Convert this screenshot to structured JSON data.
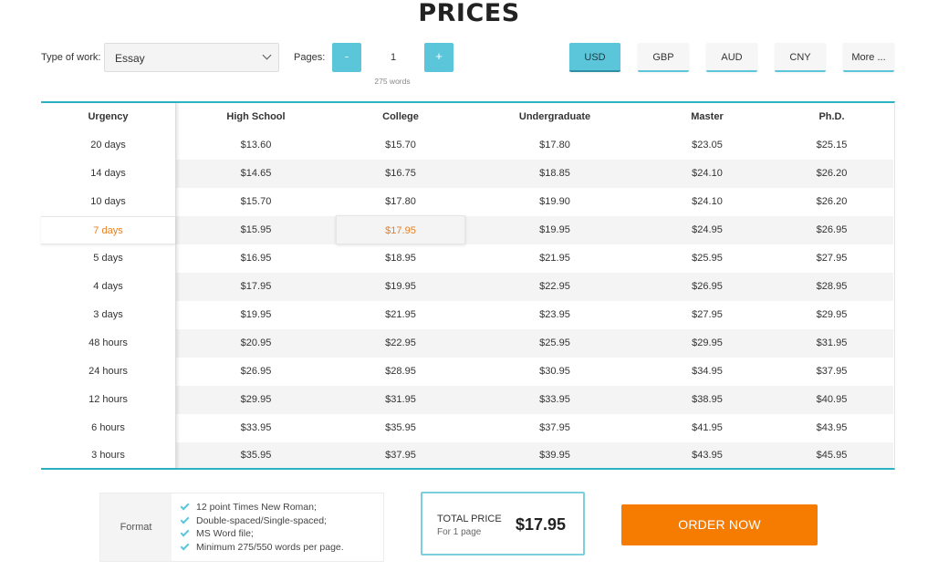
{
  "title": "PRICES",
  "controls": {
    "type_label": "Type of work:",
    "type_value": "Essay",
    "pages_label": "Pages:",
    "minus": "-",
    "plus": "+",
    "pages_value": "1",
    "words_note": "275 words"
  },
  "currencies": [
    "USD",
    "GBP",
    "AUD",
    "CNY",
    "More ..."
  ],
  "active_currency": "USD",
  "table": {
    "urgency_header": "Urgency",
    "levels": [
      "High School",
      "College",
      "Undergraduate",
      "Master",
      "Ph.D."
    ],
    "rows": [
      {
        "urgency": "20 days",
        "prices": [
          "$13.60",
          "$15.70",
          "$17.80",
          "$23.05",
          "$25.15"
        ]
      },
      {
        "urgency": "14 days",
        "prices": [
          "$14.65",
          "$16.75",
          "$18.85",
          "$24.10",
          "$26.20"
        ]
      },
      {
        "urgency": "10 days",
        "prices": [
          "$15.70",
          "$17.80",
          "$19.90",
          "$24.10",
          "$26.20"
        ]
      },
      {
        "urgency": "7 days",
        "prices": [
          "$15.95",
          "$17.95",
          "$19.95",
          "$24.95",
          "$26.95"
        ]
      },
      {
        "urgency": "5 days",
        "prices": [
          "$16.95",
          "$18.95",
          "$21.95",
          "$25.95",
          "$27.95"
        ]
      },
      {
        "urgency": "4 days",
        "prices": [
          "$17.95",
          "$19.95",
          "$22.95",
          "$26.95",
          "$28.95"
        ]
      },
      {
        "urgency": "3 days",
        "prices": [
          "$19.95",
          "$21.95",
          "$23.95",
          "$27.95",
          "$29.95"
        ]
      },
      {
        "urgency": "48 hours",
        "prices": [
          "$20.95",
          "$22.95",
          "$25.95",
          "$29.95",
          "$31.95"
        ]
      },
      {
        "urgency": "24 hours",
        "prices": [
          "$26.95",
          "$28.95",
          "$30.95",
          "$34.95",
          "$37.95"
        ]
      },
      {
        "urgency": "12 hours",
        "prices": [
          "$29.95",
          "$31.95",
          "$33.95",
          "$38.95",
          "$40.95"
        ]
      },
      {
        "urgency": "6 hours",
        "prices": [
          "$33.95",
          "$35.95",
          "$37.95",
          "$41.95",
          "$43.95"
        ]
      },
      {
        "urgency": "3 hours",
        "prices": [
          "$35.95",
          "$37.95",
          "$39.95",
          "$43.95",
          "$45.95"
        ]
      }
    ],
    "selected_row": 3,
    "selected_col": 1
  },
  "format": {
    "label": "Format",
    "items": [
      "12 point Times New Roman;",
      "Double-spaced/Single-spaced;",
      "MS Word file;",
      "Minimum 275/550 words per page."
    ]
  },
  "total": {
    "label": "TOTAL PRICE",
    "sub": "For 1 page",
    "amount": "$17.95"
  },
  "order_button": "ORDER NOW",
  "colors": {
    "accent": "#5bc6da",
    "border_accent": "#2bb3c5",
    "selected_text": "#e87f22",
    "order_button": "#f57c00"
  }
}
